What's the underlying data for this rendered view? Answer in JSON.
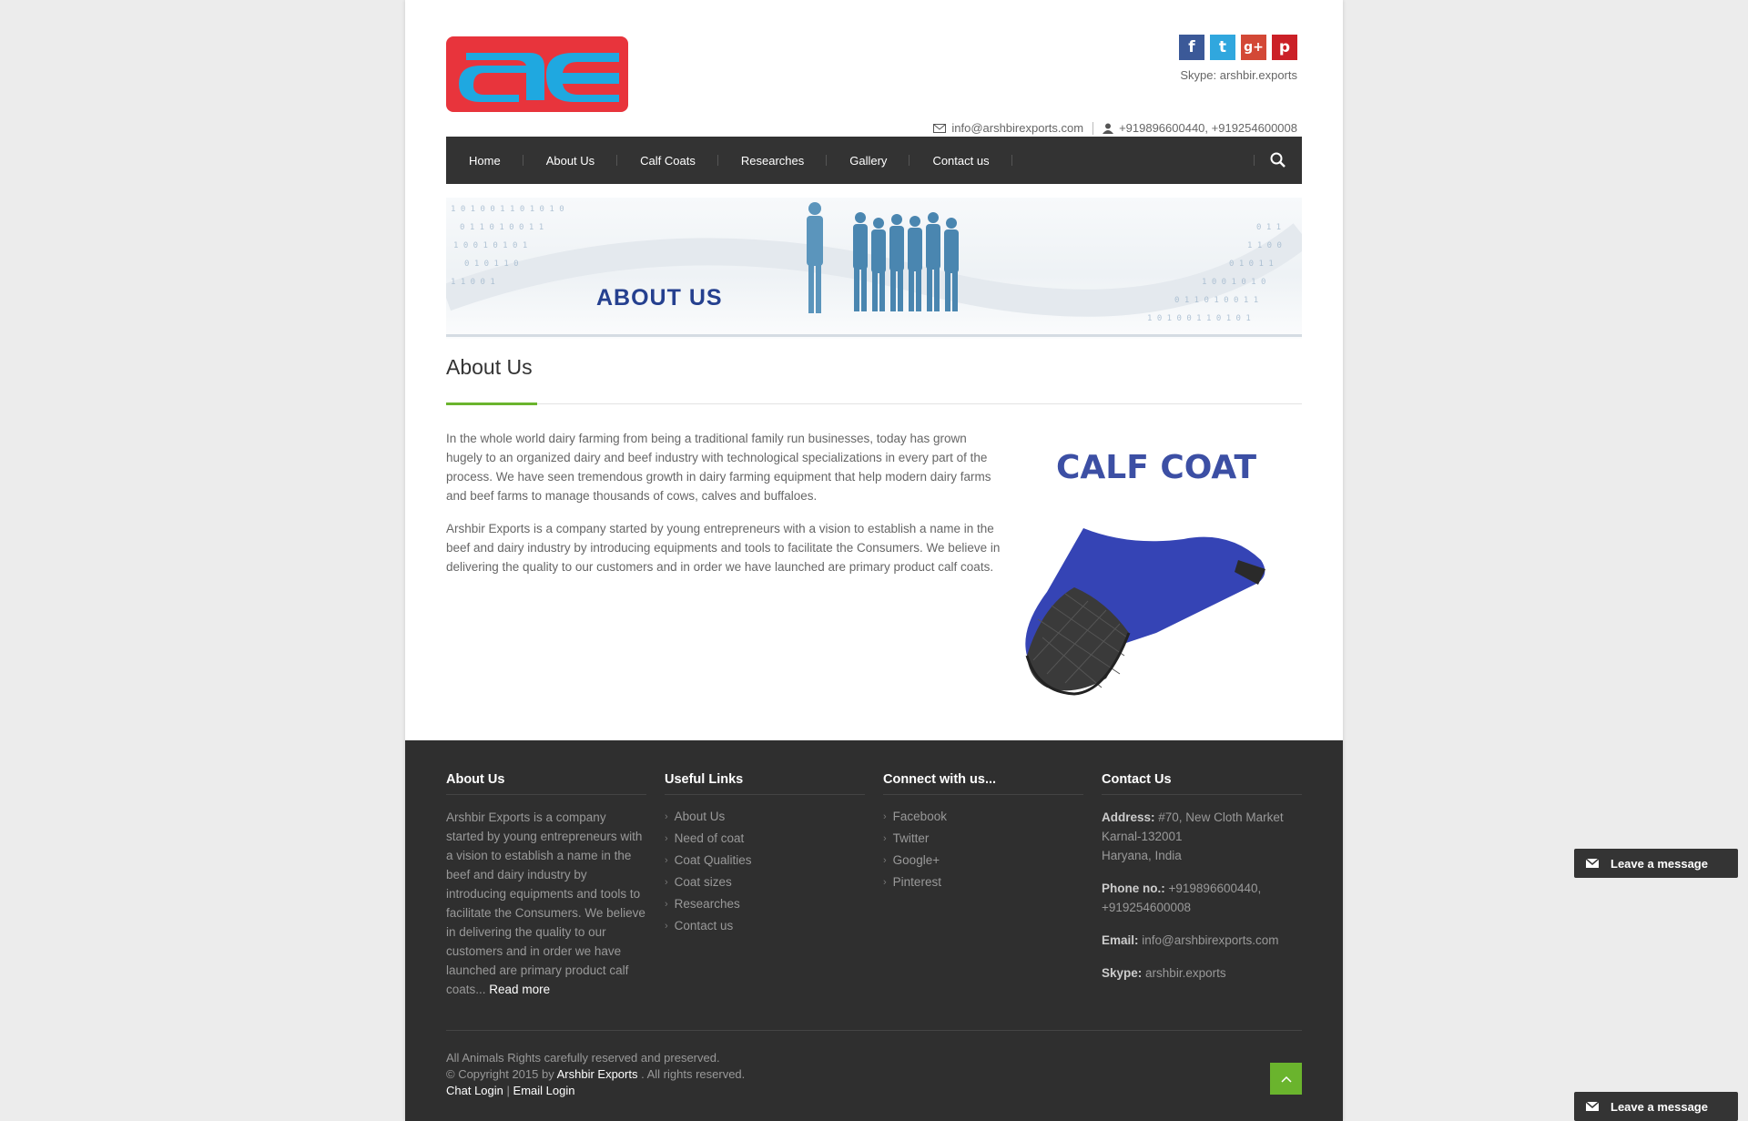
{
  "header": {
    "social": [
      {
        "name": "facebook",
        "glyph": "f",
        "color": "#3b5998"
      },
      {
        "name": "twitter",
        "glyph": "t",
        "color": "#30a7de"
      },
      {
        "name": "google-plus",
        "glyph": "g+",
        "color": "#d34836"
      },
      {
        "name": "pinterest",
        "glyph": "p",
        "color": "#cb2027"
      }
    ],
    "skype": "Skype: arshbir.exports",
    "email": "info@arshbirexports.com",
    "phone": "+919896600440, +919254600008"
  },
  "nav": {
    "items": [
      "Home",
      "About Us",
      "Calf Coats",
      "Researches",
      "Gallery",
      "Contact us"
    ]
  },
  "banner": {
    "title": "ABOUT US"
  },
  "main": {
    "title": "About Us",
    "paragraphs": [
      "In the whole world dairy farming from being a traditional family run businesses, today has grown hugely to an organized dairy and beef industry with technological specializations in every part of the process. We have seen tremendous growth in dairy farming equipment that help modern dairy farms and beef farms to manage thousands of cows, calves and buffaloes.",
      "Arshbir Exports is a company started by young entrepreneurs with a vision to establish a name in the beef and dairy industry by introducing equipments and tools to facilitate the Consumers. We believe in delivering the quality to our customers and in order we have launched are primary product calf coats."
    ],
    "product_title": "CALF COAT"
  },
  "footer": {
    "about": {
      "heading": "About Us",
      "text": "Arshbir Exports is a company started by young entrepreneurs with a vision to establish a name in the beef and dairy industry by introducing equipments and tools to facilitate the Consumers. We believe in delivering the quality to our customers and in order we have launched are primary product calf coats...",
      "read_more": "Read more"
    },
    "useful_links": {
      "heading": "Useful Links",
      "items": [
        "About Us",
        "Need of coat",
        "Coat Qualities",
        "Coat sizes",
        "Researches",
        "Contact us"
      ]
    },
    "connect": {
      "heading": "Connect with us...",
      "items": [
        "Facebook",
        "Twitter",
        "Google+",
        "Pinterest"
      ]
    },
    "contact": {
      "heading": "Contact Us",
      "address_label": "Address:",
      "address_line1": "#70, New Cloth Market",
      "address_line2": "Karnal-132001",
      "address_line3": "Haryana, India",
      "phone_label": "Phone no.:",
      "phone_line1": "+919896600440,",
      "phone_line2": "+919254600008",
      "email_label": "Email:",
      "email": "info@arshbirexports.com",
      "skype_label": "Skype:",
      "skype": "arshbir.exports"
    },
    "copyright": {
      "line1": "All Animals Rights carefully reserved and preserved.",
      "line2_prefix": "© Copyright 2015 by",
      "company": "Arshbir Exports",
      "line2_suffix": ". All rights reserved.",
      "chat_login": "Chat Login",
      "separator": "|",
      "email_login": "Email Login"
    }
  },
  "chat_widget": {
    "label": "Leave a message"
  }
}
